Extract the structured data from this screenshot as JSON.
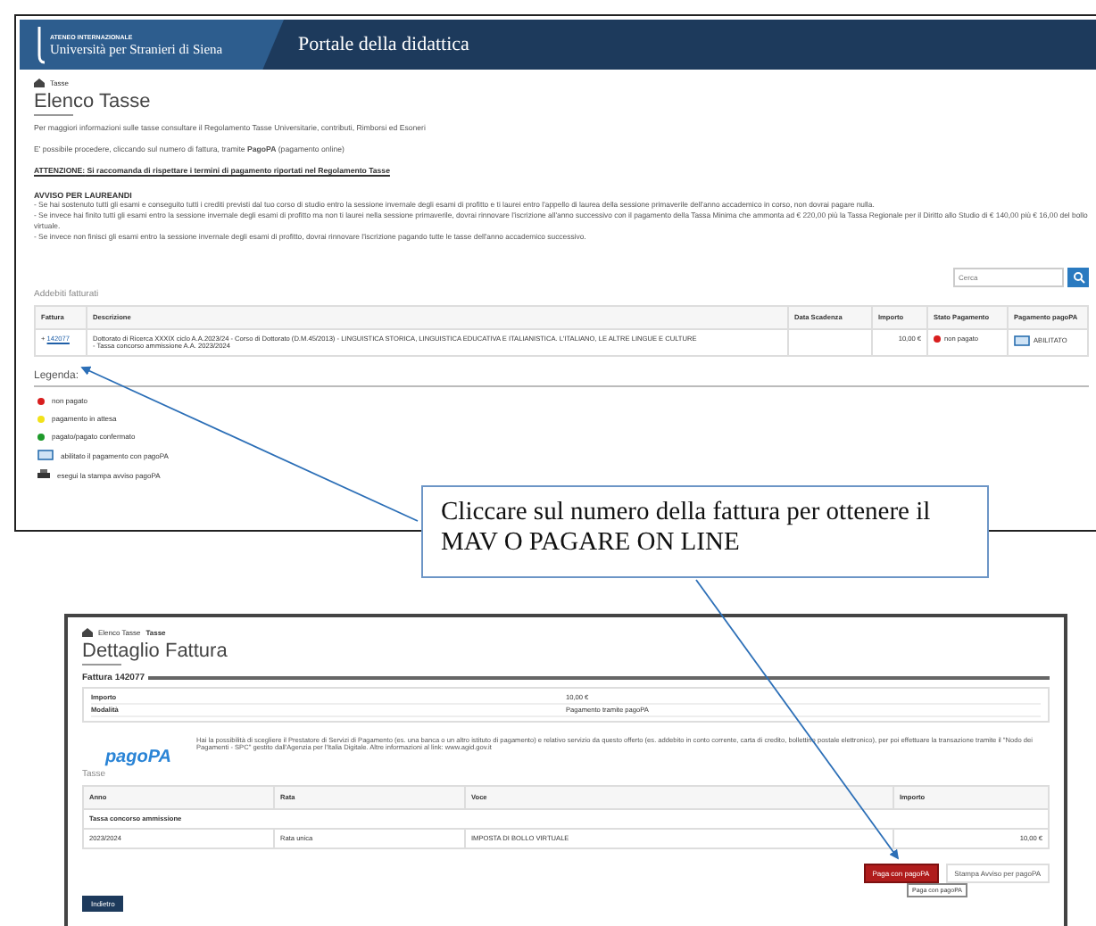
{
  "top_screen": {
    "header": {
      "logo_caption": "ATENEO INTERNAZIONALE",
      "logo": "Università per Stranieri di Siena",
      "portal_title": "Portale della didattica"
    },
    "breadcrumb": [
      "Tasse"
    ],
    "title": "Elenco Tasse",
    "paragraphs": [
      "Per maggiori informazioni sulle tasse consultare il Regolamento Tasse Universitarie, contributi, Rimborsi ed Esoneri",
      "E' possibile procedere, cliccando sul numero di fattura, tramite **PagoPA** (pagamento online)",
      "**ATTENZIONE:** Si raccomanda di rispettare i termini di pagamento riportati nel Regolamento Tasse"
    ],
    "notice": {
      "title": "AVVISO PER LAUREANDI",
      "lines": [
        "- Se hai sostenuto tutti gli esami e conseguito tutti i crediti previsti dal tuo corso di studio entro la sessione invernale degli esami di profitto e ti laurei entro l'appello di laurea della sessione primaverile dell'anno accademico in corso, non dovrai pagare nulla.",
        "- Se invece hai finito tutti gli esami entro la sessione invernale degli esami di profitto ma non ti laurei nella sessione primaverile, dovrai rinnovare l'iscrizione all'anno successivo con il pagamento della Tassa Minima che ammonta ad € 220,00 più la Tassa Regionale per il Diritto allo Studio di € 140,00 più € 16,00 del bollo virtuale.",
        "- Se invece non finisci gli esami entro la sessione invernale degli esami di profitto, dovrai rinnovare l'iscrizione pagando tutte le tasse dell'anno accademico successivo."
      ]
    },
    "search": {
      "placeholder": "Cerca"
    },
    "section_title": "Addebiti fatturati",
    "table": {
      "columns": [
        "Fattura",
        "Descrizione",
        "Data Scadenza",
        "Importo",
        "Stato Pagamento",
        "Pagamento pagoPA"
      ],
      "rows": [
        {
          "expander": "+",
          "invoice": "142077",
          "description": "Dottorato di Ricerca XXXIX ciclo A.A.2023/24 - Corso di Dottorato (D.M.45/2013) - LINGUISTICA STORICA, LINGUISTICA EDUCATIVA E ITALIANISTICA. L'ITALIANO, LE ALTRE LINGUE E CULTURE",
          "detail": "- Tassa concorso ammissione A.A. 2023/2024",
          "amount": "10,00 €",
          "status": "non pagato",
          "color": "#d81e1e",
          "pagopa": "ABILITATO"
        }
      ]
    },
    "legend": {
      "title": "Legenda:",
      "items": [
        {
          "kind": "dot",
          "color": "#d81e1e",
          "label": "non pagato"
        },
        {
          "kind": "dot",
          "color": "#f2e21a",
          "label": "pagamento in attesa"
        },
        {
          "kind": "dot",
          "color": "#1e9a2a",
          "label": "pagato/pagato confermato"
        },
        {
          "kind": "pagopa",
          "label": "abilitato il pagamento con pagoPA"
        },
        {
          "kind": "print",
          "label": "esegui la stampa avviso pagoPA"
        }
      ]
    }
  },
  "callout": "Cliccare sul numero della fattura per ottenere il MAV O PAGARE ON LINE",
  "bottom_screen": {
    "breadcrumb": [
      "Elenco Tasse",
      "Tasse"
    ],
    "title": "Dettaglio Fattura",
    "invoice_legend": "Fattura 142077",
    "details": [
      {
        "label": "Importo",
        "value": "10,00 €"
      },
      {
        "label": "Modalità",
        "value": "Pagamento tramite pagoPA"
      }
    ],
    "pagopa_logo": "pagoPA",
    "pagopa_text": "Hai la possibilità di scegliere il Prestatore di Servizi di Pagamento (es. una banca o un altro istituto di pagamento) e relativo servizio da questo offerto (es. addebito in conto corrente, carta di credito, bollettino postale elettronico), per poi effettuare la transazione tramite il \"Nodo dei Pagamenti - SPC\" gestito dall'Agenzia per l'Italia Digitale. Altre informazioni al link: www.agid.gov.it",
    "taxes_title": "Tasse",
    "taxes_columns": [
      "Anno",
      "Rata",
      "Voce",
      "Importo"
    ],
    "tax_group": "Tassa concorso ammissione",
    "tax_rows": [
      {
        "year": "2023/2024",
        "installment": "Rata unica",
        "item": "IMPOSTA DI BOLLO VIRTUALE",
        "amount": "10,00 €"
      }
    ],
    "pay_button": "Paga con pagoPA",
    "print_button": "Stampa Avviso per pagoPA",
    "tooltip": "Paga con pagoPA",
    "back_button": "Indietro"
  }
}
